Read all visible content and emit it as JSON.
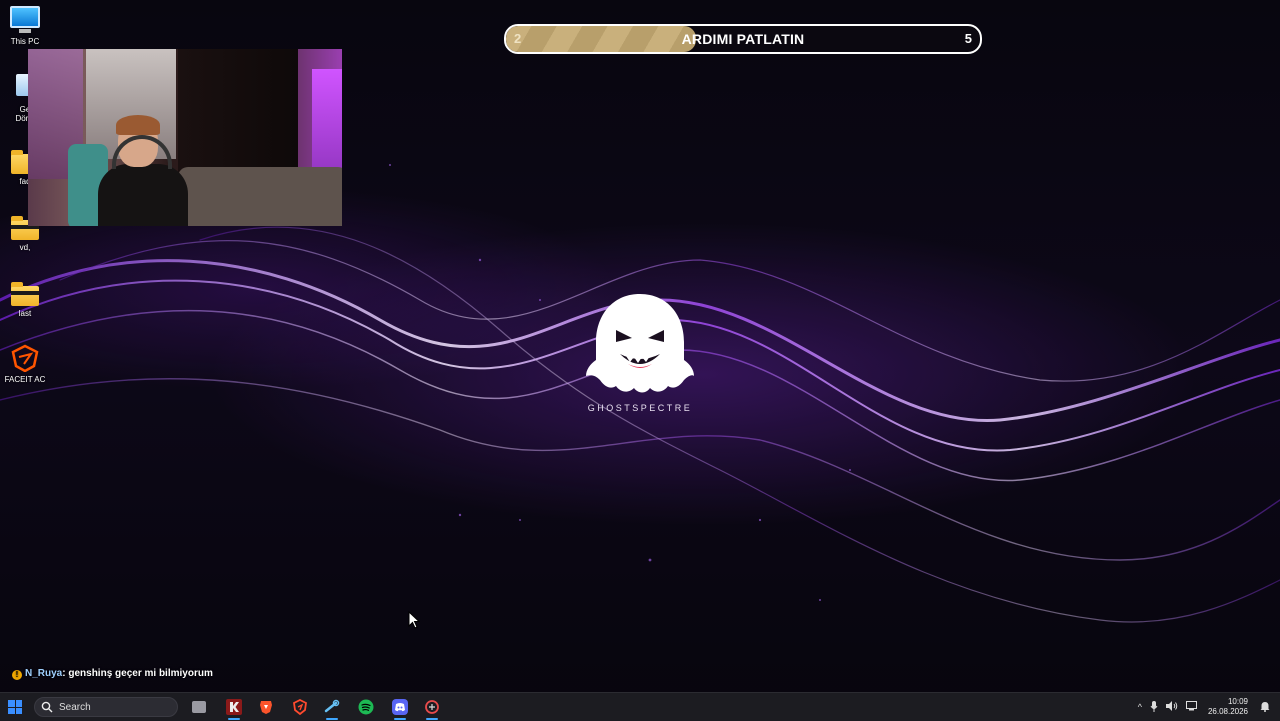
{
  "desktop_icons": [
    {
      "label": "This PC",
      "icon": "this-pc-icon"
    },
    {
      "label": "Ge\nDönü",
      "icon": "recycle-bin-icon"
    },
    {
      "label": "fad",
      "icon": "folder-icon"
    },
    {
      "label": "vd,",
      "icon": "folder-icon"
    },
    {
      "label": "last",
      "icon": "folder-icon"
    },
    {
      "label": "FACEIT AC",
      "icon": "faceit-icon"
    }
  ],
  "goal_overlay": {
    "title": "ARDIMI PATLATIN",
    "current": "2",
    "target": "5",
    "progress_fraction": 0.4,
    "fill_color": "#c9b07c"
  },
  "wallpaper": {
    "brand_text": "GHOSTSPECTRE",
    "accent_color": "#8a2be2"
  },
  "chat": {
    "username": "N_Ruya",
    "message": ": genshinş geçer mi bilmiyorum"
  },
  "taskbar": {
    "search_placeholder": "Search",
    "apps": [
      {
        "icon": "task-view-icon",
        "color": "#aaaaaa"
      },
      {
        "icon": "kick-app-icon",
        "color": "#e0e0e0"
      },
      {
        "icon": "brave-browser-icon",
        "color": "#fb542b"
      },
      {
        "icon": "shield-app-icon",
        "color": "#ff4a2e"
      },
      {
        "icon": "steam-icon",
        "color": "#66c0f4"
      },
      {
        "icon": "spotify-icon",
        "color": "#1db954"
      },
      {
        "icon": "discord-icon",
        "color": "#5865f2"
      },
      {
        "icon": "screenshot-tool-icon",
        "color": "#e84b4b"
      }
    ],
    "time": "10:09",
    "date": "26.08.2026"
  }
}
